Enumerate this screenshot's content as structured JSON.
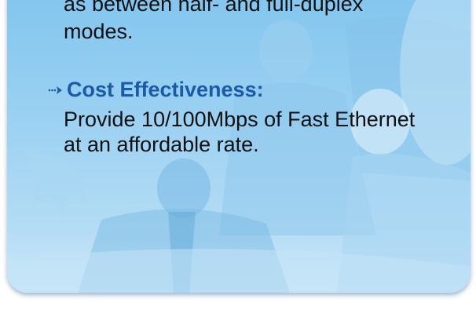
{
  "content": {
    "intro_line_1": "as between half- and full-duplex",
    "intro_line_2": "modes.",
    "feature_heading": "Cost Effectiveness:",
    "feature_line_1": "Provide 10/100Mbps of Fast Ethernet",
    "feature_line_2": "at an affordable rate."
  },
  "colors": {
    "panel_top": "#7fc4ee",
    "panel_bottom": "#cfe9fa",
    "heading": "#1a5aa6",
    "body_text": "#111111",
    "bullet_arrow": "#1a5aa6"
  },
  "icons": {
    "bullet": "dotted-arrow-icon"
  }
}
